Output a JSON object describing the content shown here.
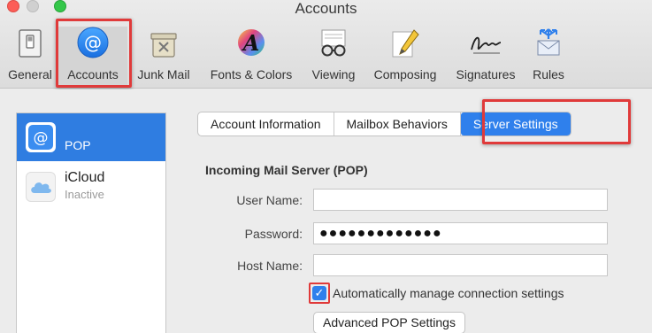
{
  "window": {
    "title": "Accounts"
  },
  "toolbar": {
    "items": [
      {
        "label": "General",
        "icon": "general-switch-icon"
      },
      {
        "label": "Accounts",
        "icon": "at-sign-icon"
      },
      {
        "label": "Junk Mail",
        "icon": "junk-mail-icon"
      },
      {
        "label": "Fonts & Colors",
        "icon": "fonts-colors-icon"
      },
      {
        "label": "Viewing",
        "icon": "glasses-icon"
      },
      {
        "label": "Composing",
        "icon": "pencil-icon"
      },
      {
        "label": "Signatures",
        "icon": "signature-icon"
      },
      {
        "label": "Rules",
        "icon": "rules-arrows-icon"
      }
    ],
    "selected": "Accounts"
  },
  "sidebar": {
    "accounts": [
      {
        "name": "POP",
        "status": "",
        "icon": "at-sign-icon",
        "selected": true
      },
      {
        "name": "iCloud",
        "status": "Inactive",
        "icon": "cloud-icon",
        "selected": false
      }
    ]
  },
  "tabs": {
    "items": [
      "Account Information",
      "Mailbox Behaviors",
      "Server Settings"
    ],
    "active": "Server Settings"
  },
  "incoming": {
    "section_title": "Incoming Mail Server (POP)",
    "user_name_label": "User Name:",
    "user_name_value": "",
    "password_label": "Password:",
    "password_value": "●●●●●●●●●●●●●",
    "host_name_label": "Host Name:",
    "host_name_value": "",
    "auto_manage_label": "Automatically manage connection settings",
    "auto_manage_checked": true,
    "advanced_button": "Advanced POP Settings"
  },
  "colors": {
    "accent": "#2f80ec",
    "highlight": "#e03a3a"
  }
}
